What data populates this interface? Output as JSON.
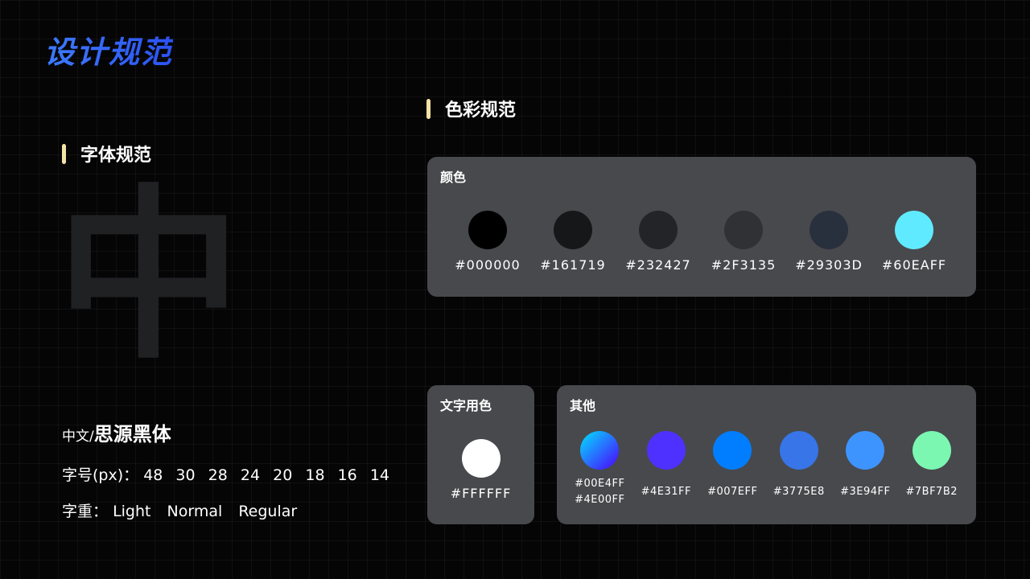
{
  "title": "设计规范",
  "typography": {
    "heading": "字体规范",
    "sample_char": "中",
    "family_prefix": "中文/",
    "family_name": "思源黑体",
    "sizes_label": "字号(px)：",
    "sizes": [
      "48",
      "30",
      "28",
      "24",
      "20",
      "18",
      "16",
      "14"
    ],
    "weights_label": "字重：",
    "weights": [
      "Light",
      "Normal",
      "Regular"
    ]
  },
  "colors": {
    "heading": "色彩规范",
    "palette": {
      "title": "颜色",
      "items": [
        {
          "hex": "#000000",
          "color": "#000000"
        },
        {
          "hex": "#161719",
          "color": "#161719"
        },
        {
          "hex": "#232427",
          "color": "#232427"
        },
        {
          "hex": "#2F3135",
          "color": "#2F3135"
        },
        {
          "hex": "#29303D",
          "color": "#29303D"
        },
        {
          "hex": "#60EAFF",
          "color": "#60EAFF"
        }
      ]
    },
    "text_color": {
      "title": "文字用色",
      "hex": "#FFFFFF",
      "color": "#FFFFFF"
    },
    "others": {
      "title": "其他",
      "items": [
        {
          "hex": "#00E4FF",
          "hex2": "#4E00FF",
          "color": "#00E4FF",
          "color2": "#4E00FF",
          "gradient": true
        },
        {
          "hex": "#4E31FF",
          "color": "#4E31FF"
        },
        {
          "hex": "#007EFF",
          "color": "#007EFF"
        },
        {
          "hex": "#3775E8",
          "color": "#3775E8"
        },
        {
          "hex": "#3E94FF",
          "color": "#3E94FF"
        },
        {
          "hex": "#7BF7B2",
          "color": "#7BF7B2"
        }
      ]
    }
  }
}
